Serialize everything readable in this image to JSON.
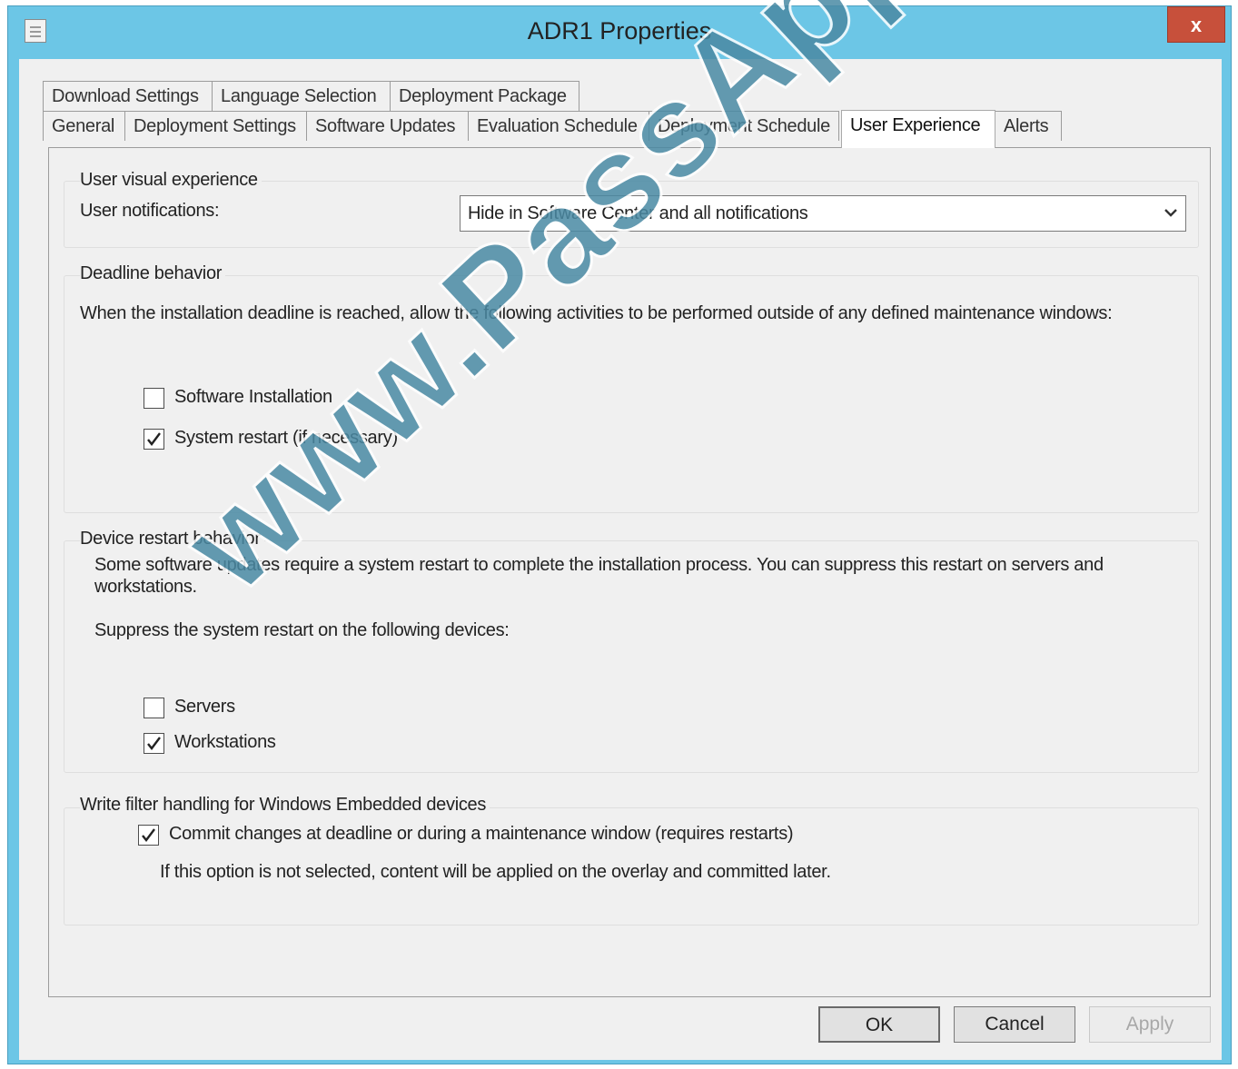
{
  "window": {
    "title": "ADR1 Properties",
    "close_glyph": "x"
  },
  "tabs_row1": [
    "Download Settings",
    "Language Selection",
    "Deployment Package"
  ],
  "tabs_row2": [
    "General",
    "Deployment Settings",
    "Software Updates",
    "Evaluation Schedule",
    "Deployment Schedule",
    "User Experience",
    "Alerts"
  ],
  "selected_tab": "User Experience",
  "user_visual": {
    "group_label": "User visual experience",
    "notifications_label": "User notifications:",
    "notifications_value": "Hide in Software Center and all notifications"
  },
  "deadline": {
    "group_label": "Deadline behavior",
    "description": "When the installation deadline is reached, allow the following activities to be performed outside of any defined maintenance windows:",
    "software_installation": {
      "label": "Software Installation",
      "checked": false
    },
    "system_restart": {
      "label": "System restart (if necessary)",
      "checked": true
    }
  },
  "device_restart": {
    "group_label": "Device restart behavior",
    "description_line1": "Some software updates require a system restart to complete the installation process. You can suppress this restart on servers and",
    "description_line2": "workstations.",
    "suppress_label": "Suppress the system restart on the following devices:",
    "servers": {
      "label": "Servers",
      "checked": false
    },
    "workstations": {
      "label": "Workstations",
      "checked": true
    }
  },
  "write_filter": {
    "group_label": "Write filter handling for Windows Embedded devices",
    "commit": {
      "label": "Commit changes at deadline or during a maintenance window (requires restarts)",
      "checked": true
    },
    "note": "If this option is not selected, content will be applied on the overlay and committed later."
  },
  "buttons": {
    "ok": "OK",
    "cancel": "Cancel",
    "apply": "Apply"
  },
  "watermark": "www.PassApply.com",
  "icons": {
    "app": "properties-window-icon",
    "dropdown": "chevron-down-icon",
    "check": "checkmark-icon"
  }
}
